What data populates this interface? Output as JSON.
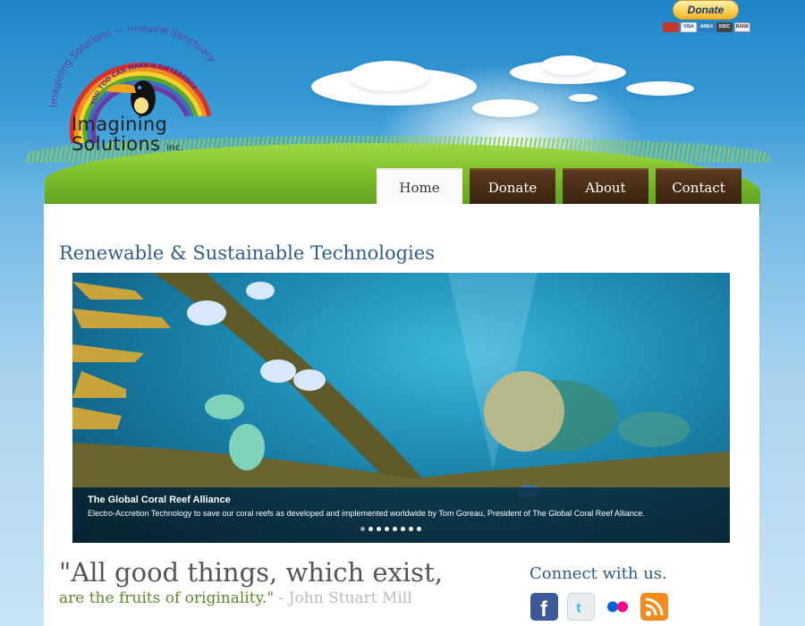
{
  "logo": {
    "arc_text": "Imagining Solutions — Imagine Sanctuary",
    "slogan": "YOU TOO CAN MAKE A DIFFERENCE",
    "brand_line1": "Imagining",
    "brand_line2": "Solutions",
    "brand_suffix": "inc."
  },
  "donate": {
    "button_label": "Donate",
    "cards": [
      "VISA",
      "AMEX",
      "DISC",
      "BANK"
    ]
  },
  "nav": [
    {
      "label": "Home",
      "active": true
    },
    {
      "label": "Donate",
      "active": false
    },
    {
      "label": "About",
      "active": false
    },
    {
      "label": "Contact",
      "active": false
    }
  ],
  "main": {
    "page_title": "Renewable & Sustainable Technologies",
    "slider": {
      "caption_title": "The Global Coral Reef Alliance",
      "caption_text": "Electro-Accretion Technology to save our coral reefs as developed and implemented worldwide by Tom Goreau, President of The Global Coral Reef Alliance.",
      "slide_count": 8,
      "active_slide": 1
    },
    "quote": {
      "line1": "\"All good things, which exist,",
      "line2": "are the fruits of originality.\"",
      "author": " - John Stuart Mill"
    },
    "connect": {
      "title": "Connect with us.",
      "icons": [
        "facebook-icon",
        "twitter-icon",
        "flickr-icon",
        "rss-icon"
      ]
    }
  },
  "colors": {
    "nav_brown": "#4a2e16",
    "title_blue": "#2f5d8c",
    "quote_green": "#5c8a2a"
  }
}
